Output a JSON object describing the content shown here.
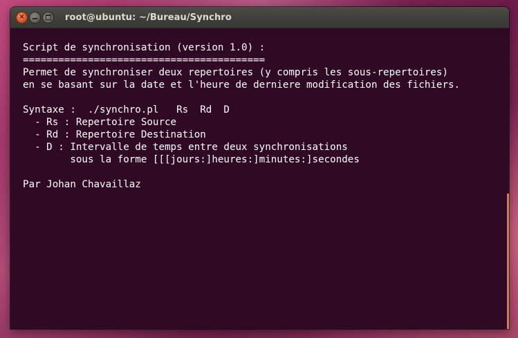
{
  "window": {
    "title": "root@ubuntu: ~/Bureau/Synchro",
    "buttons": {
      "close_glyph": "×",
      "close_icon": "close-icon",
      "minimize_icon": "minimize-icon",
      "maximize_icon": "maximize-icon"
    }
  },
  "terminal": {
    "background": "#300a24",
    "foreground": "#ffffff",
    "lines": [
      "Script de synchronisation (version 1.0) :",
      "=========================================",
      "Permet de synchroniser deux repertoires (y compris les sous-repertoires)",
      "en se basant sur la date et l'heure de derniere modification des fichiers.",
      "",
      "Syntaxe :  ./synchro.pl   Rs  Rd  D",
      "  - Rs : Repertoire Source",
      "  - Rd : Repertoire Destination",
      "  - D : Intervalle de temps entre deux synchronisations",
      "        sous la forme [[[jours:]heures:]minutes:]secondes",
      "",
      "Par Johan Chavaillaz"
    ]
  }
}
